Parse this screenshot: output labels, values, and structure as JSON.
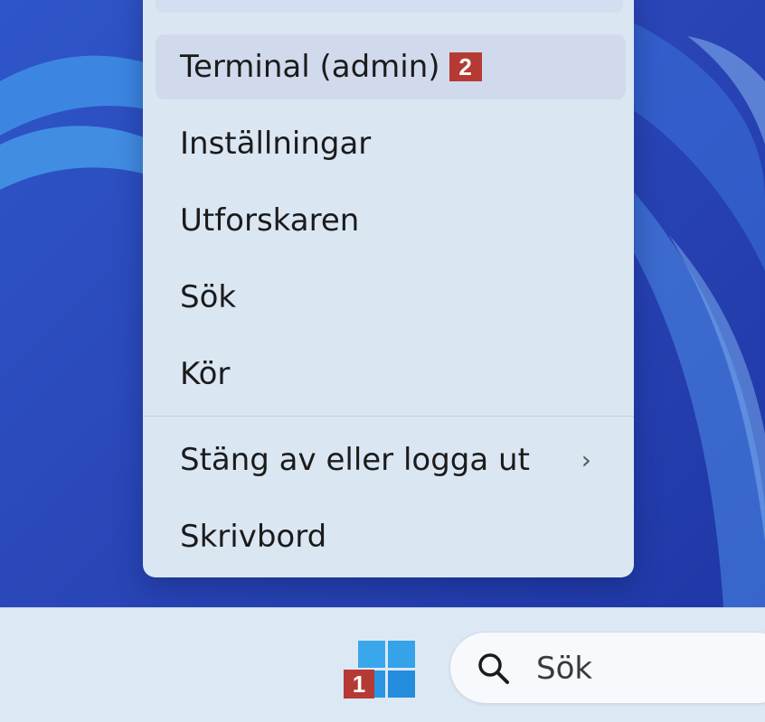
{
  "menu": {
    "items": [
      {
        "label": "Terminal (admin)",
        "badge": "2",
        "highlighted": true
      },
      {
        "label": "Inställningar"
      },
      {
        "label": "Utforskaren"
      },
      {
        "label": "Sök"
      },
      {
        "label": "Kör"
      },
      {
        "label": "Stäng av eller logga ut",
        "submenu_icon": "chevron-right-icon"
      },
      {
        "label": "Skrivbord"
      }
    ],
    "chevron": "›"
  },
  "taskbar": {
    "start_badge": "1",
    "search_placeholder": "Sök",
    "start_icon": "windows-logo-icon",
    "search_icon": "search-icon"
  },
  "colors": {
    "wallpaper": "#2a47b8",
    "menu_bg": "#dbe6f3",
    "taskbar_bg": "#dde8f5",
    "badge": "#b63a34",
    "windows_logo": "#2c9ae6"
  }
}
